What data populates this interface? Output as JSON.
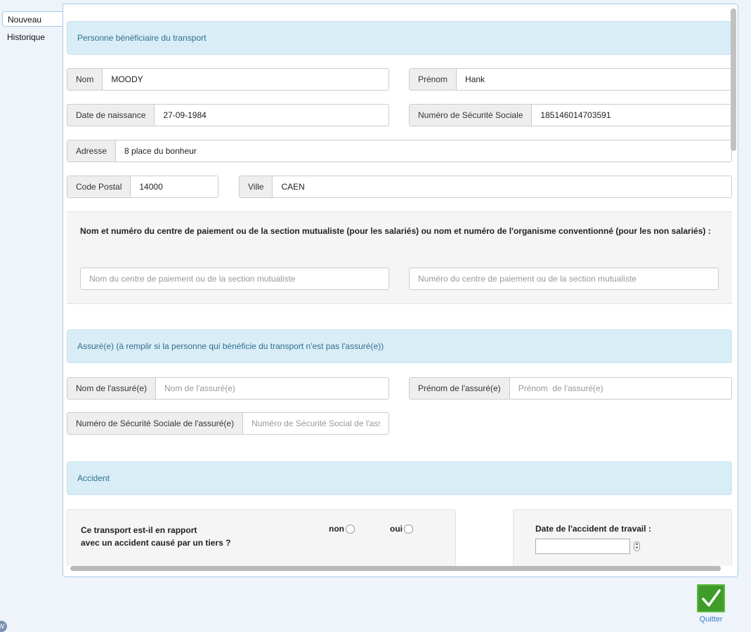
{
  "tabs": {
    "new": "Nouveau",
    "history": "Historique"
  },
  "beneficiary": {
    "header": "Personne bénéficiaire du transport",
    "nom_label": "Nom",
    "nom_value": "MOODY",
    "prenom_label": "Prénom",
    "prenom_value": "Hank",
    "dob_label": "Date de naissance",
    "dob_value": "27-09-1984",
    "ssn_label": "Numéro de Sécurité Sociale",
    "ssn_value": "185146014703591",
    "address_label": "Adresse",
    "address_value": "8 place du bonheur",
    "zip_label": "Code Postal",
    "zip_value": "14000",
    "city_label": "Ville",
    "city_value": "CAEN"
  },
  "payment": {
    "title": "Nom et numéro du centre de paiement ou de la section mutualiste (pour les salariés) ou nom et numéro de l'organisme conventionné (pour les non salariés) :",
    "name_placeholder": "Nom du centre de paiement ou de la section mutualiste",
    "number_placeholder": "Numéro du centre de paiement ou de la section mutualiste"
  },
  "insured": {
    "header": "Assuré(e) (à remplir si la personne qui bénéficie du transport n'est pas l'assuré(e))",
    "nom_label": "Nom de l'assuré(e)",
    "nom_placeholder": "Nom de l'assuré(e)",
    "prenom_label": "Prénom de l'assuré(e)",
    "prenom_placeholder": "Prénom  de l'assuré(e)",
    "ssn_label": "Numéro de Sécurité Sociale de l'assuré(e)",
    "ssn_placeholder": "Numéro de Sécurité Social de l'assuré(e)"
  },
  "accident": {
    "header": "Accident",
    "question_line1": "Ce transport est-il en rapport",
    "question_line2": "avec un accident causé par un tiers ?",
    "no_label": "non",
    "yes_label": "oui",
    "date_label": "Date de l'accident de travail :"
  },
  "footer": {
    "quit_label": "Quitter",
    "logo_text": "W"
  },
  "colors": {
    "accent": "#31708f",
    "quit": "#3f9c2a"
  }
}
